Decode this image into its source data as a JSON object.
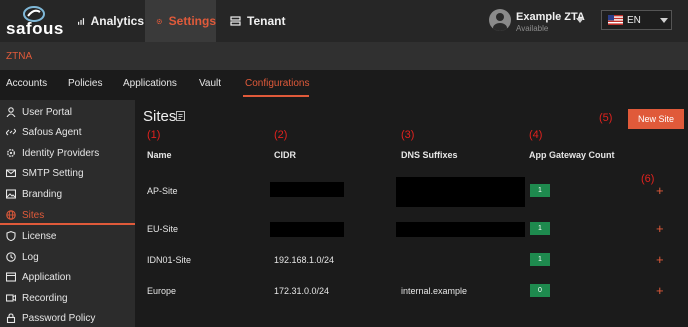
{
  "header": {
    "logo_text": "safous",
    "nav": [
      {
        "label": "Analytics",
        "icon": "analytics-icon"
      },
      {
        "label": "Settings",
        "icon": "gear-icon",
        "active": true
      },
      {
        "label": "Tenant",
        "icon": "tenant-icon"
      }
    ],
    "user": {
      "name": "Example ZTA",
      "status": "Available"
    },
    "language": {
      "code": "EN",
      "flag": "us-flag-icon"
    }
  },
  "section_label": "ZTNA",
  "subtabs": [
    "Accounts",
    "Policies",
    "Applications",
    "Vault",
    "Configurations"
  ],
  "active_subtab": "Configurations",
  "sidebar": {
    "items": [
      {
        "label": "User Portal",
        "icon": "user-icon"
      },
      {
        "label": "Safous Agent",
        "icon": "link-icon"
      },
      {
        "label": "Identity Providers",
        "icon": "gear-icon"
      },
      {
        "label": "SMTP Setting",
        "icon": "mail-icon"
      },
      {
        "label": "Branding",
        "icon": "image-icon"
      },
      {
        "label": "Sites",
        "icon": "globe-icon",
        "active": true
      },
      {
        "label": "License",
        "icon": "shield-icon"
      },
      {
        "label": "Log",
        "icon": "log-icon"
      },
      {
        "label": "Application",
        "icon": "app-icon"
      },
      {
        "label": "Recording",
        "icon": "recording-icon"
      },
      {
        "label": "Password Policy",
        "icon": "lock-icon"
      }
    ]
  },
  "main": {
    "title": "Sites",
    "new_site_label": "New Site",
    "annotations": [
      "(1)",
      "(2)",
      "(3)",
      "(4)",
      "(5)",
      "(6)"
    ],
    "columns": [
      "Name",
      "CIDR",
      "DNS Suffixes",
      "App Gateway Count"
    ],
    "rows": [
      {
        "name": "AP-Site",
        "cidr": "",
        "dns": "",
        "count": "1",
        "redacted": true
      },
      {
        "name": "EU-Site",
        "cidr": "",
        "dns": "",
        "count": "1",
        "redacted": true
      },
      {
        "name": "IDN01-Site",
        "cidr": "192.168.1.0/24",
        "dns": "",
        "count": "1",
        "redacted": false
      },
      {
        "name": "Europe",
        "cidr": "172.31.0.0/24",
        "dns": "internal.example",
        "count": "0",
        "redacted": false
      }
    ],
    "add_symbol": "+"
  },
  "colors": {
    "accent": "#e05a3a",
    "badge": "#1e8a4e",
    "annotation": "#e0221e"
  }
}
